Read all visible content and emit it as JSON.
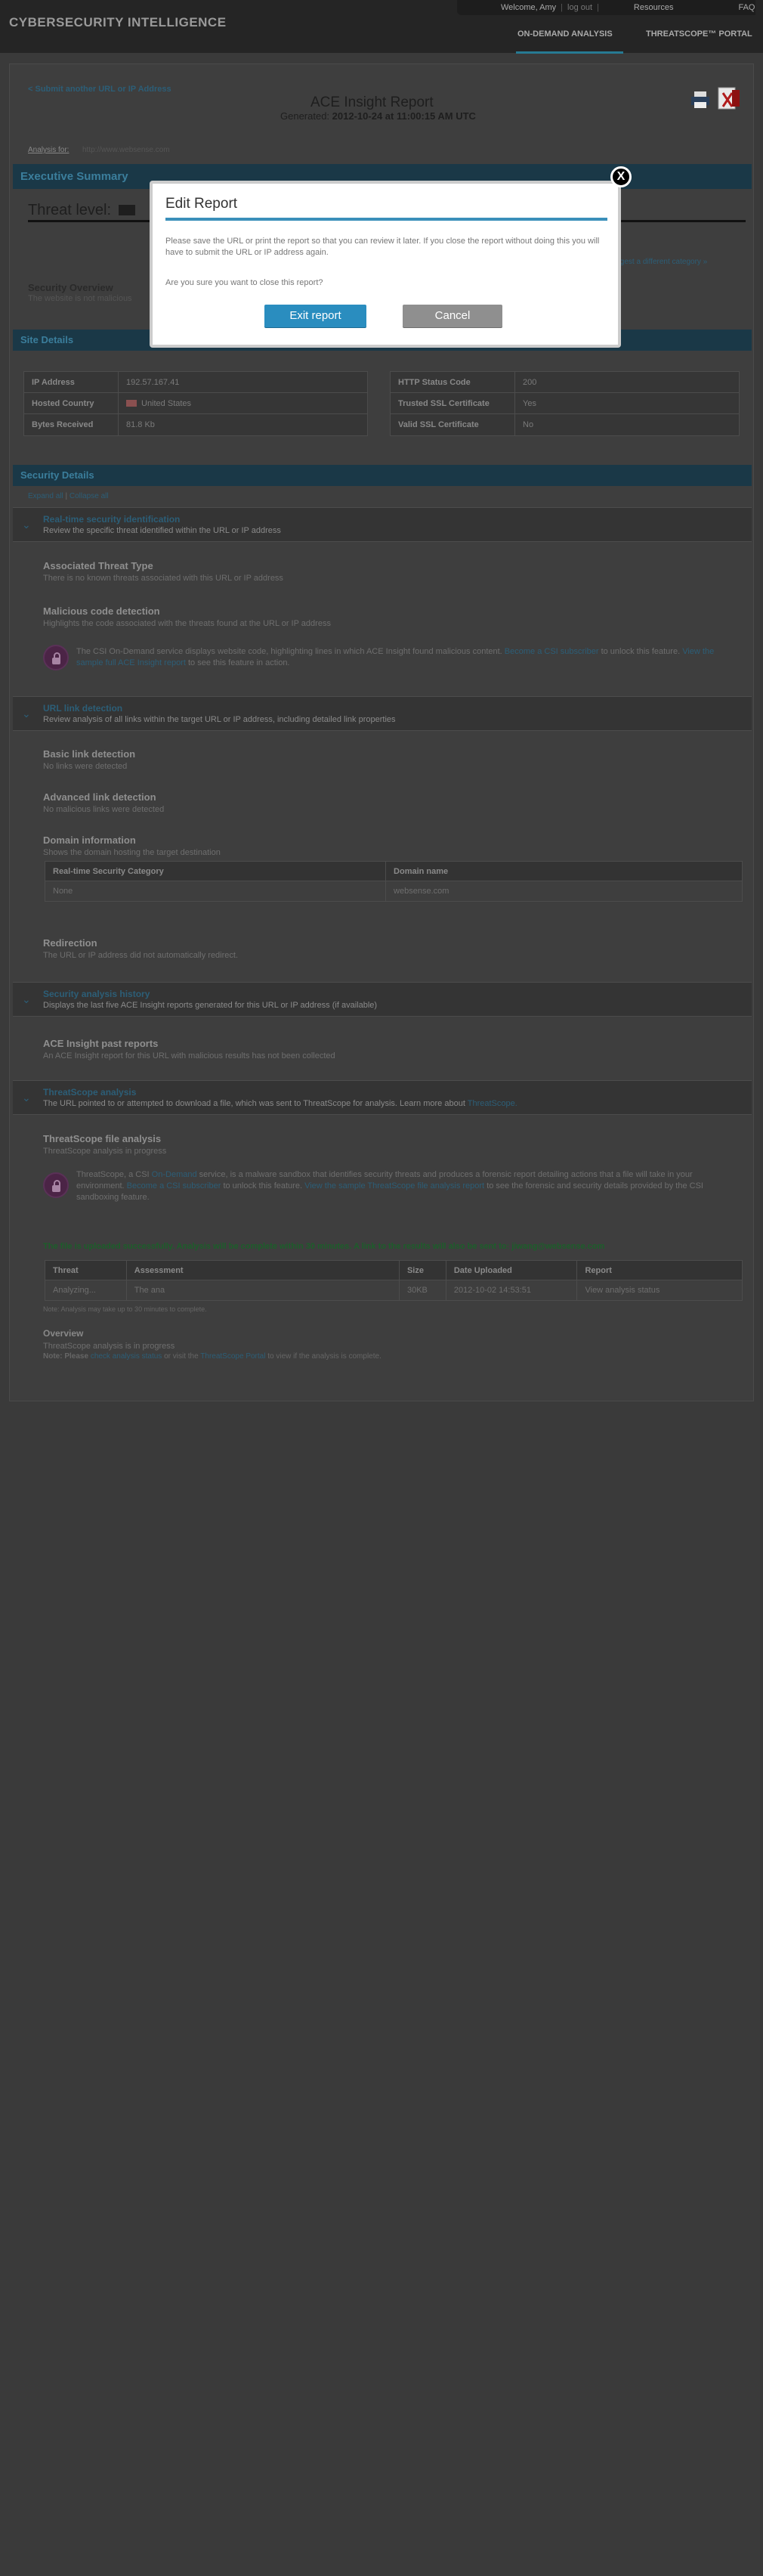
{
  "header": {
    "brand": "CYBERSECURITY INTELLIGENCE",
    "welcome": "Welcome, Amy",
    "logout": "log out",
    "link_resources": "Resources",
    "link_faq": "FAQ",
    "nav": [
      "ON-DEMAND ANALYSIS",
      "THREATSCOPE™ PORTAL"
    ]
  },
  "report": {
    "back_link": "< Submit another URL or IP Address",
    "title": "ACE Insight Report",
    "generated_label": "Generated:",
    "generated_value": "2012-10-24 at 11:00:15 AM UTC",
    "analysis_label": "Analysis for:",
    "analysis_url": "http://www.websense.com",
    "exec_summary": "Executive Summary",
    "threat_level": "Threat level:",
    "suggest_link": "Suggest a different category »",
    "security_overview": "Security Overview",
    "security_overview_text": "The website is not malicious",
    "site_details": "Site Details"
  },
  "site_details": {
    "left": [
      {
        "k": "IP Address",
        "v": "192.57.167.41"
      },
      {
        "k": "Hosted Country",
        "v": "United States"
      },
      {
        "k": "Bytes Received",
        "v": "81.8 Kb"
      }
    ],
    "right": [
      {
        "k": "HTTP Status Code",
        "v": "200"
      },
      {
        "k": "Trusted SSL Certificate",
        "v": "Yes"
      },
      {
        "k": "Valid SSL Certificate",
        "v": "No"
      }
    ]
  },
  "security_details": {
    "title": "Security Details",
    "expand": "Expand all",
    "collapse": "Collapse all",
    "s1_title": "Real-time security identification",
    "s1_desc": "Review the specific threat identified within the URL or IP address",
    "assoc_title": "Associated Threat Type",
    "assoc_text": "There is no known threats associated with this URL or IP address",
    "mal_title": "Malicious code detection",
    "mal_text": "Highlights the code associated with the threats found at the URL or IP address",
    "mal_p1": "The CSI On-Demand service displays website code, highlighting lines in which ACE Insight found malicious content.",
    "mal_link1": "Become a CSI subscriber",
    "mal_p2": "to unlock this feature.",
    "mal_link2": "View the sample full ACE Insight report",
    "mal_p3": "to see this feature in action.",
    "s2_title": "URL link detection",
    "s2_desc": "Review analysis of all links within the target URL or IP address, including detailed link properties",
    "basic_title": "Basic link detection",
    "basic_text": "No links were detected",
    "adv_title": "Advanced link detection",
    "adv_text": "No malicious links were detected",
    "domain_title": "Domain information",
    "domain_text": "Shows the domain hosting the target destination",
    "domain_cols": [
      "Real-time Security Category",
      "Domain name"
    ],
    "domain_row": [
      "None",
      "websense.com"
    ],
    "redir_title": "Redirection",
    "redir_text": "The URL or IP address did not automatically redirect.",
    "s3_title": "Security analysis history",
    "s3_desc": "Displays the last five ACE Insight reports generated for this URL or IP address (if available)",
    "past_title": "ACE Insight past reports",
    "past_text": "An ACE Insight report for this URL with malicious results has not been collected",
    "s4_title": "ThreatScope analysis",
    "s4_desc": "The URL pointed to or attempted to download a file, which was sent to ThreatScope for analysis. Learn more about",
    "s4_link": "ThreatScope.",
    "file_title": "ThreatScope file analysis",
    "file_text": "ThreatScope analysis in progress",
    "ts_p1": "ThreatScope, a CSI",
    "ts_link0": "On-Demand",
    "ts_p2": "service, is a malware sandbox that identifies security threats and produces a forensic report detailing actions that a file will take in your environment.",
    "ts_link1": "Become a CSI subscriber",
    "ts_p3": "to unlock this feature.",
    "ts_link2": "View the sample ThreatScope file analysis report",
    "ts_p4": "to see the forensic and security details provided by the CSI sandboxing feature.",
    "success_msg": "The file is uploaded successfully. Analysis will be complete within 30 minutes. A link to the results will also be sent to: jiwang@websense.com",
    "file_cols": [
      "Threat",
      "Assessment",
      "Size",
      "Date Uploaded",
      "Report"
    ],
    "file_row": [
      "Analyzing...",
      "The ana",
      "30KB",
      "2012-10-02 14:53:51",
      "View analysis status"
    ],
    "note1": "Note: Analysis may take up to 30 minutes to complete.",
    "overview_title": "Overview",
    "overview_text": "ThreatScope analysis is in progress",
    "note2_a": "Note: Please",
    "note2_link1": "check analysis status",
    "note2_b": "or visit the",
    "note2_link2": "ThreatScope Portal",
    "note2_c": "to view if the analysis is complete."
  },
  "modal": {
    "title": "Edit Report",
    "message": "Please save the URL or print the report so that you can review it later. If you close the report without doing this you will have to submit the URL or IP address again.",
    "question": "Are you sure you want to close this report?",
    "exit": "Exit report",
    "cancel": "Cancel",
    "close": "X"
  }
}
